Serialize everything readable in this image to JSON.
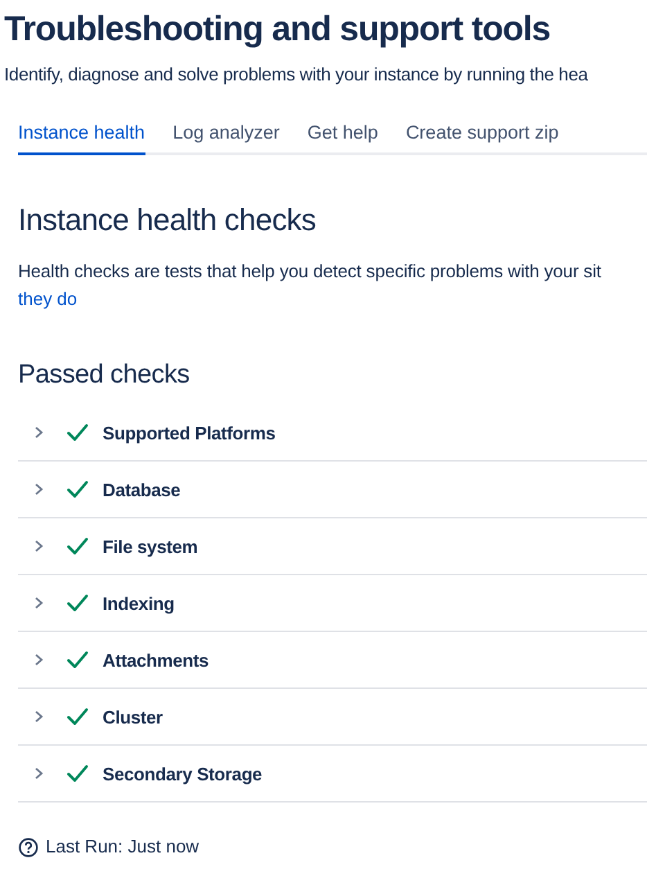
{
  "page": {
    "title": "Troubleshooting and support tools",
    "subtitle": "Identify, diagnose and solve problems with your instance by running the hea"
  },
  "tabs": [
    {
      "label": "Instance health",
      "selected": true
    },
    {
      "label": "Log analyzer",
      "selected": false
    },
    {
      "label": "Get help",
      "selected": false
    },
    {
      "label": "Create support zip",
      "selected": false
    }
  ],
  "section": {
    "heading": "Instance health checks",
    "description": "Health checks are tests that help you detect specific problems with your sit",
    "link": "they do"
  },
  "passed_checks": {
    "heading": "Passed checks",
    "items": [
      {
        "label": "Supported Platforms",
        "expanded": false,
        "passed": true
      },
      {
        "label": "Database",
        "expanded": false,
        "passed": true
      },
      {
        "label": "File system",
        "expanded": false,
        "passed": true
      },
      {
        "label": "Indexing",
        "expanded": false,
        "passed": true
      },
      {
        "label": "Attachments",
        "expanded": false,
        "passed": true
      },
      {
        "label": "Cluster",
        "expanded": false,
        "passed": true
      },
      {
        "label": "Secondary Storage",
        "expanded": false,
        "passed": true
      }
    ]
  },
  "last_run": "Last Run: Just now"
}
